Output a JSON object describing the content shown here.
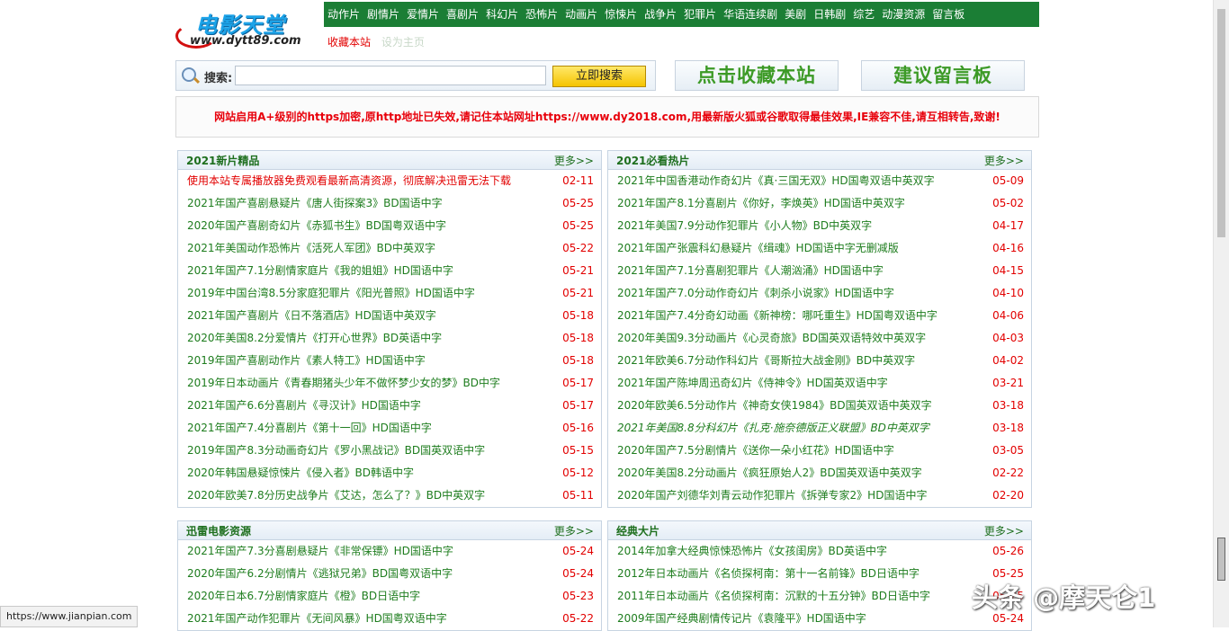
{
  "logo": {
    "title": "电影天堂",
    "url": "www.dytt89.com"
  },
  "nav": [
    "动作片",
    "剧情片",
    "爱情片",
    "喜剧片",
    "科幻片",
    "恐怖片",
    "动画片",
    "惊悚片",
    "战争片",
    "犯罪片",
    "华语连续剧",
    "美剧",
    "日韩剧",
    "综艺",
    "动漫资源",
    "留言板"
  ],
  "subnav": {
    "bookmark": "收藏本站",
    "homepage": "设为主页",
    "bookmark_color": "#e20000",
    "homepage_color": "#c8d8c8"
  },
  "search": {
    "label": "搜索:",
    "value": "",
    "button": "立即搜索"
  },
  "buttons": {
    "collect": "点击收藏本站",
    "guestbook": "建议留言板"
  },
  "notice": "网站启用A+级别的https加密,原http地址已失效,请记住本站网址https://www.dy2018.com,用最新版火狐或谷歌取得最佳效果,IE兼容不佳,请互相转告,致谢!",
  "more": "更多>>",
  "boxes": [
    {
      "title": "2021新片精品",
      "items": [
        {
          "name": "使用本站专属播放器免费观看最新高清资源，彻底解决迅雷无法下载",
          "date": "02-11",
          "style": "red"
        },
        {
          "name": "2021年国产喜剧悬疑片《唐人街探案3》BD国语中字",
          "date": "05-25"
        },
        {
          "name": "2020年国产喜剧奇幻片《赤狐书生》BD国粤双语中字",
          "date": "05-25"
        },
        {
          "name": "2021年美国动作恐怖片《活死人军团》BD中英双字",
          "date": "05-22"
        },
        {
          "name": "2021年国产7.1分剧情家庭片《我的姐姐》HD国语中字",
          "date": "05-21"
        },
        {
          "name": "2019年中国台湾8.5分家庭犯罪片《阳光普照》HD国语中字",
          "date": "05-21"
        },
        {
          "name": "2021年国产喜剧片《日不落酒店》HD国语中英双字",
          "date": "05-18"
        },
        {
          "name": "2020年美国8.2分爱情片《打开心世界》BD英语中字",
          "date": "05-18"
        },
        {
          "name": "2019年国产喜剧动作片《素人特工》HD国语中字",
          "date": "05-18"
        },
        {
          "name": "2019年日本动画片《青春期猪头少年不做怀梦少女的梦》BD中字",
          "date": "05-17"
        },
        {
          "name": "2021年国产6.6分喜剧片《寻汉计》HD国语中字",
          "date": "05-17"
        },
        {
          "name": "2021年国产7.4分喜剧片《第十一回》HD国语中字",
          "date": "05-16"
        },
        {
          "name": "2019年国产8.3分动画奇幻片《罗小黑战记》BD国英双语中字",
          "date": "05-15"
        },
        {
          "name": "2020年韩国悬疑惊悚片《侵入者》BD韩语中字",
          "date": "05-12"
        },
        {
          "name": "2020年欧美7.8分历史战争片《艾达，怎么了？》BD中英双字",
          "date": "05-11"
        }
      ]
    },
    {
      "title": "2021必看热片",
      "items": [
        {
          "name": "2021年中国香港动作奇幻片《真·三国无双》HD国粤双语中英双字",
          "date": "05-09"
        },
        {
          "name": "2021年国产8.1分喜剧片《你好，李焕英》HD国语中英双字",
          "date": "05-02"
        },
        {
          "name": "2021年美国7.9分动作犯罪片《小人物》BD中英双字",
          "date": "04-17"
        },
        {
          "name": "2021年国产张震科幻悬疑片《缉魂》HD国语中字无删减版",
          "date": "04-16"
        },
        {
          "name": "2021年国产7.1分喜剧犯罪片《人潮汹涌》HD国语中字",
          "date": "04-15"
        },
        {
          "name": "2021年国产7.0分动作奇幻片《刺杀小说家》HD国语中字",
          "date": "04-10"
        },
        {
          "name": "2021年国产7.4分奇幻动画《新神榜：哪吒重生》HD国粤双语中字",
          "date": "04-06"
        },
        {
          "name": "2020年美国9.3分动画片《心灵奇旅》BD国英双语特效中英双字",
          "date": "04-03"
        },
        {
          "name": "2021年欧美6.7分动作科幻片《哥斯拉大战金刚》BD中英双字",
          "date": "04-02"
        },
        {
          "name": "2021年国产陈坤周迅奇幻片《侍神令》HD国英双语中字",
          "date": "03-21"
        },
        {
          "name": "2020年欧美6.5分动作片《神奇女侠1984》BD国英双语中英双字",
          "date": "03-18"
        },
        {
          "name": "2021年美国8.8分科幻片《扎克·施奈德版正义联盟》BD中英双字",
          "date": "03-18",
          "style": "ital"
        },
        {
          "name": "2020年国产7.5分剧情片《送你一朵小红花》HD国语中字",
          "date": "03-05"
        },
        {
          "name": "2020年美国8.2分动画片《疯狂原始人2》BD国英双语中英双字",
          "date": "02-22"
        },
        {
          "name": "2020年国产刘德华刘青云动作犯罪片《拆弹专家2》HD国语中字",
          "date": "02-20"
        }
      ]
    },
    {
      "title": "迅雷电影资源",
      "items": [
        {
          "name": "2021年国产7.3分喜剧悬疑片《非常保镖》HD国语中字",
          "date": "05-24"
        },
        {
          "name": "2020年国产6.2分剧情片《逃狱兄弟》BD国粤双语中字",
          "date": "05-24"
        },
        {
          "name": "2020年日本6.7分剧情家庭片《橙》BD日语中字",
          "date": "05-23"
        },
        {
          "name": "2021年国产动作犯罪片《无间风暴》HD国粤双语中字",
          "date": "05-22"
        }
      ]
    },
    {
      "title": "经典大片",
      "items": [
        {
          "name": "2014年加拿大经典惊悚恐怖片《女孩闺房》BD英语中字",
          "date": "05-26"
        },
        {
          "name": "2012年日本动画片《名侦探柯南：第十一名前锋》BD日语中字",
          "date": "05-25"
        },
        {
          "name": "2011年日本动画片《名侦探柯南：沉默的十五分钟》BD日语中字",
          "date": "05-25"
        },
        {
          "name": "2009年国产经典剧情传记片《袁隆平》HD国语中字",
          "date": "05-24"
        }
      ]
    }
  ],
  "status_url": "https://www.jianpian.com",
  "watermark": "头条 @摩天仑1"
}
